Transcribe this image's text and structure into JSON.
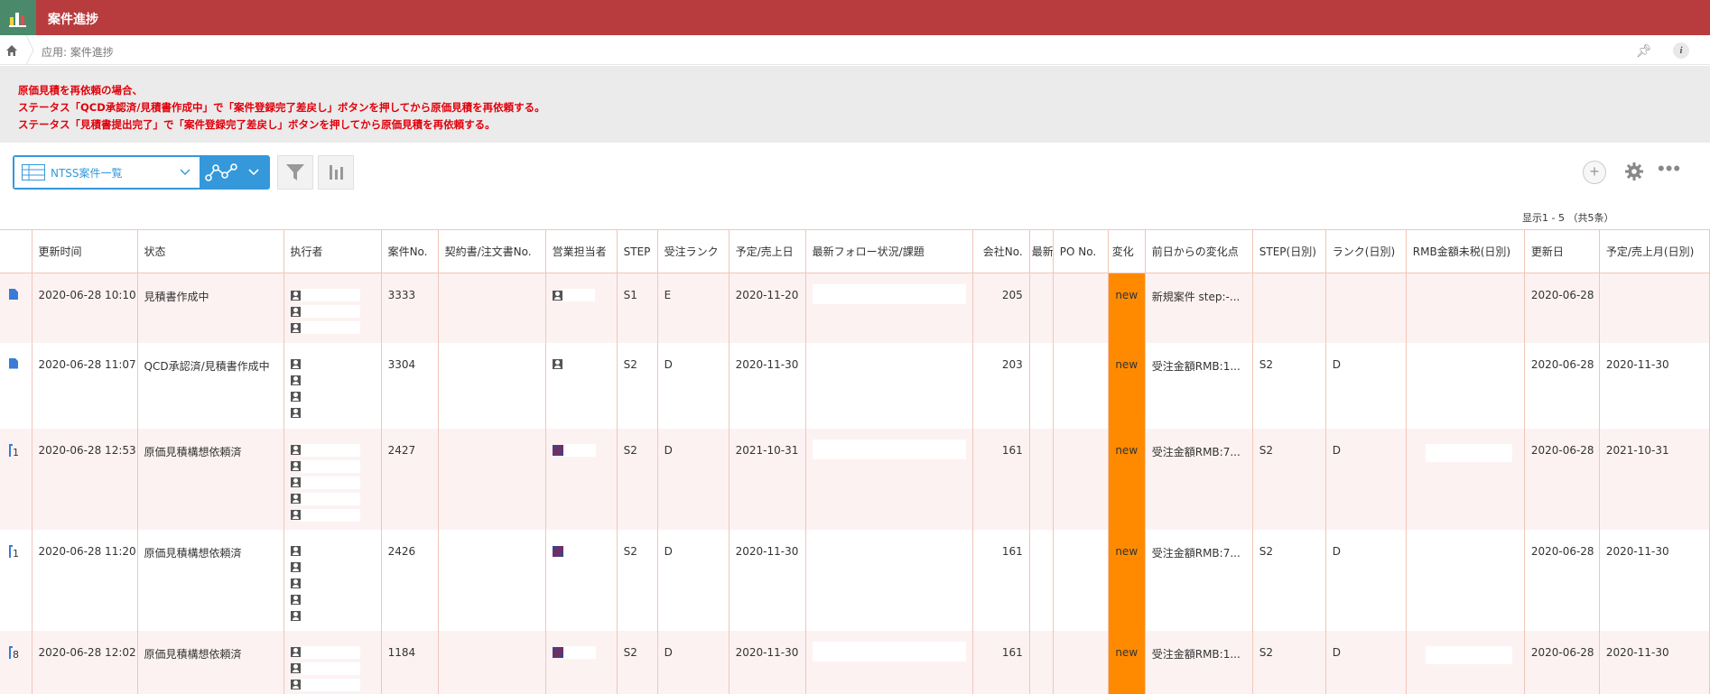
{
  "header": {
    "title": "案件進捗"
  },
  "breadcrumb": {
    "text": "应用: 案件進捗"
  },
  "notice": {
    "lines": [
      "原価見積を再依頼の場合、",
      "ステータス「QCD承認済/見積書作成中」で「案件登録完了差戻し」ボタンを押してから原価見積を再依頼する。",
      "ステータス「見積書提出完了」で「案件登録完了差戻し」ボタンを押してから原価見積を再依頼する。"
    ]
  },
  "toolbar": {
    "view_name": "NTSS案件一覧",
    "pager": "显示1 - 5 （共5条）"
  },
  "colors": {
    "header": "#b83b3e",
    "accent": "#3498db",
    "notice_text": "#e0000b",
    "change_badge": "#ff8a00"
  },
  "table": {
    "columns": [
      "",
      "更新时间",
      "状态",
      "执行者",
      "案件No.",
      "契約書/注文書No.",
      "営業担当者",
      "STEP",
      "受注ランク",
      "予定/売上日",
      "最新フォロー状況/課題",
      "会社No.",
      "最新",
      "PO No.",
      "変化",
      "前日からの変化点",
      "STEP(日別)",
      "ランク(日別)",
      "RMB金額未税(日別)",
      "更新日",
      "予定/売上月(日別)"
    ],
    "rows": [
      {
        "comments": "",
        "updated": "2020-06-28 10:10",
        "status": "見積書作成中",
        "assignees": 3,
        "case_no": "3333",
        "contract_no": "",
        "sales_type": "person",
        "step": "S1",
        "rank": "E",
        "date": "2020-11-20",
        "follow": "",
        "company_no": "205",
        "latest": "",
        "po": "",
        "change": "new",
        "diff": "新規案件 step:-...",
        "step_d": "",
        "rank_d": "",
        "rmb_d": "",
        "upd_day": "2020-06-28",
        "month_d": ""
      },
      {
        "comments": "",
        "updated": "2020-06-28 11:07",
        "status": "QCD承認済/見積書作成中",
        "assignees": 4,
        "case_no": "3304",
        "contract_no": "",
        "sales_type": "person",
        "step": "S2",
        "rank": "D",
        "date": "2020-11-30",
        "follow": "",
        "company_no": "203",
        "latest": "",
        "po": "",
        "change": "new",
        "diff": "受注金額RMB:1...",
        "step_d": "S2",
        "rank_d": "D",
        "rmb_d": "",
        "upd_day": "2020-06-28",
        "month_d": "2020-11-30"
      },
      {
        "comments": "1",
        "updated": "2020-06-28 12:53",
        "status": "原価見積構想依頼済",
        "assignees": 5,
        "case_no": "2427",
        "contract_no": "",
        "sales_type": "photo",
        "step": "S2",
        "rank": "D",
        "date": "2021-10-31",
        "follow": "",
        "company_no": "161",
        "latest": "",
        "po": "",
        "change": "new",
        "diff": "受注金額RMB:7...",
        "step_d": "S2",
        "rank_d": "D",
        "rmb_d": "",
        "upd_day": "2020-06-28",
        "month_d": "2021-10-31"
      },
      {
        "comments": "1",
        "updated": "2020-06-28 11:20",
        "status": "原価見積構想依頼済",
        "assignees": 5,
        "case_no": "2426",
        "contract_no": "",
        "sales_type": "photo",
        "step": "S2",
        "rank": "D",
        "date": "2020-11-30",
        "follow": "",
        "company_no": "161",
        "latest": "",
        "po": "",
        "change": "new",
        "diff": "受注金額RMB:7...",
        "step_d": "S2",
        "rank_d": "D",
        "rmb_d": "",
        "upd_day": "2020-06-28",
        "month_d": "2020-11-30"
      },
      {
        "comments": "8",
        "updated": "2020-06-28 12:02",
        "status": "原価見積構想依頼済",
        "assignees": 3,
        "case_no": "1184",
        "contract_no": "",
        "sales_type": "photo",
        "step": "S2",
        "rank": "D",
        "date": "2020-11-30",
        "follow": "",
        "company_no": "161",
        "latest": "",
        "po": "",
        "change": "new",
        "diff": "受注金額RMB:1...",
        "step_d": "S2",
        "rank_d": "D",
        "rmb_d": "",
        "upd_day": "2020-06-28",
        "month_d": "2020-11-30"
      }
    ]
  }
}
